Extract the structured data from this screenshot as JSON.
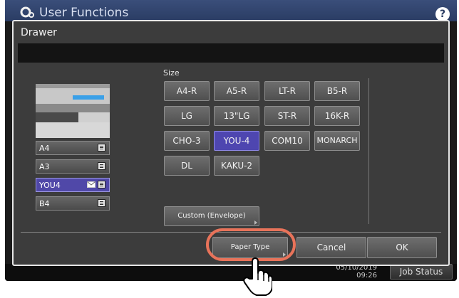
{
  "header": {
    "title": "User Functions",
    "help": "?"
  },
  "dialog": {
    "title": "Drawer",
    "message": "",
    "size_label": "Size",
    "drawers": [
      {
        "label": "A4"
      },
      {
        "label": "A3"
      },
      {
        "label": "YOU4"
      },
      {
        "label": "B4"
      }
    ],
    "sizes": [
      {
        "label": "A4-R"
      },
      {
        "label": "A5-R"
      },
      {
        "label": "LT-R"
      },
      {
        "label": "B5-R"
      },
      {
        "label": "LG"
      },
      {
        "label": "13\"LG"
      },
      {
        "label": "ST-R"
      },
      {
        "label": "16K-R"
      },
      {
        "label": "CHO-3"
      },
      {
        "label": "YOU-4"
      },
      {
        "label": "COM10"
      },
      {
        "label": "MONARCH"
      },
      {
        "label": "DL"
      },
      {
        "label": "KAKU-2"
      }
    ],
    "selected_size": "YOU-4",
    "selected_drawer": "YOU4",
    "custom_button": "Custom (Envelope)",
    "paper_type_button": "Paper Type",
    "cancel_button": "Cancel",
    "ok_button": "OK"
  },
  "status_bar": {
    "date": "05/10/2019",
    "time": "09:26",
    "job_status": "Job Status"
  },
  "colors": {
    "accent": "#4e46b0",
    "highlight": "#e8735a",
    "header": "#2a3c63"
  },
  "icons": [
    "gear-icon",
    "help-icon",
    "list-icon",
    "envelope-icon",
    "hand-pointer-icon"
  ]
}
